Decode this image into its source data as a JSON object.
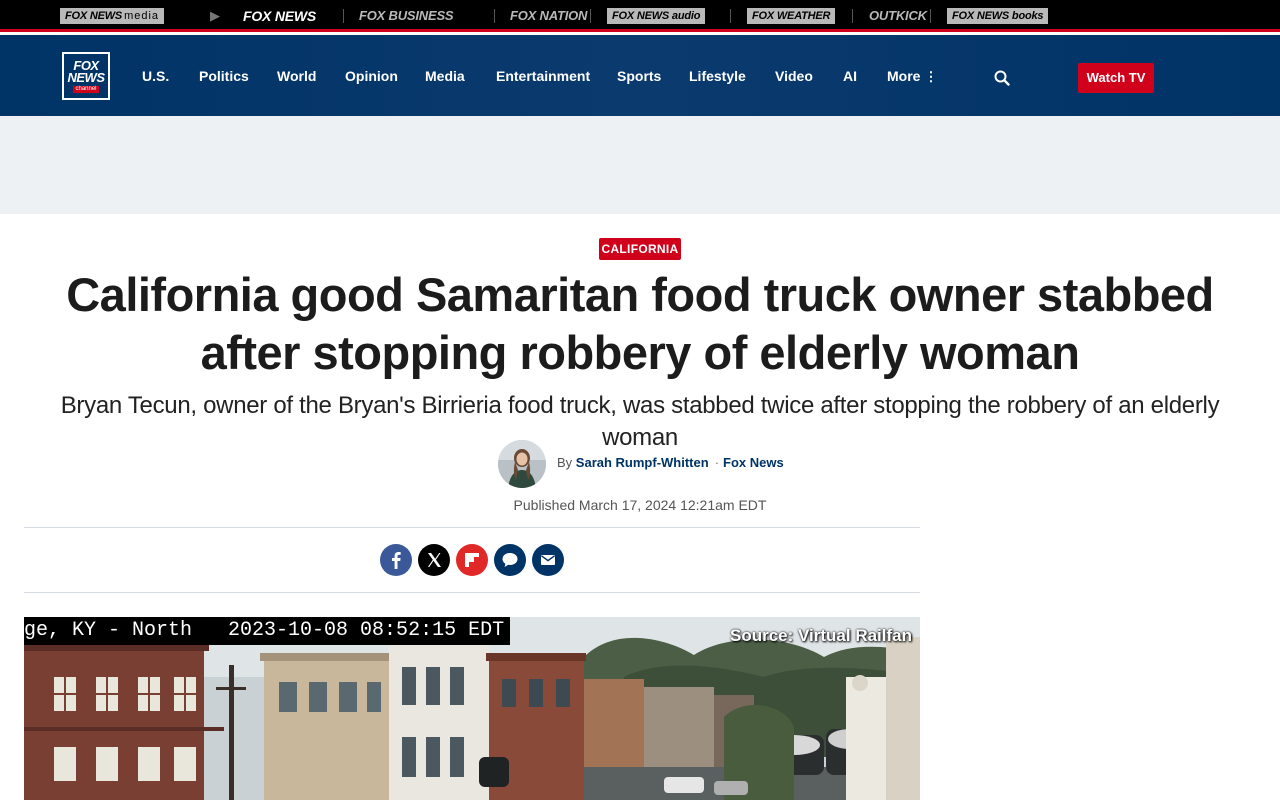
{
  "network_bar": {
    "brands": [
      {
        "key": "fox-news-media",
        "label": "FOX NEWS",
        "suffix": "media"
      },
      {
        "key": "fox-news",
        "label": "FOX NEWS"
      },
      {
        "key": "fox-business",
        "label": "FOX BUSINESS"
      },
      {
        "key": "fox-nation",
        "label": "FOX NATION"
      },
      {
        "key": "fox-news-audio",
        "label": "FOX NEWS audio"
      },
      {
        "key": "fox-weather",
        "label": "FOX WEATHER"
      },
      {
        "key": "outkick",
        "label": "OUTKICK"
      },
      {
        "key": "fox-news-books",
        "label": "FOX NEWS books"
      }
    ],
    "arrow_icon": "play-arrow-icon"
  },
  "header": {
    "logo": {
      "line1": "FOX",
      "line2": "NEWS",
      "line3": "channel"
    },
    "nav": [
      {
        "label": "U.S."
      },
      {
        "label": "Politics"
      },
      {
        "label": "World"
      },
      {
        "label": "Opinion"
      },
      {
        "label": "Media"
      },
      {
        "label": "Entertainment"
      },
      {
        "label": "Sports"
      },
      {
        "label": "Lifestyle"
      },
      {
        "label": "Video"
      },
      {
        "label": "AI"
      },
      {
        "label": "More"
      }
    ],
    "search_icon": "search-icon",
    "watch_tv_label": "Watch TV"
  },
  "article": {
    "category": "CALIFORNIA",
    "headline": "California good Samaritan food truck owner stabbed after stopping robbery of elderly woman",
    "subhead": "Bryan Tecun, owner of the Bryan's Birrieria food truck, was stabbed twice after stopping the robbery of an elderly woman",
    "byline_prefix": "By",
    "author": "Sarah Rumpf-Whitten",
    "byline_dot": "·",
    "source": "Fox News",
    "published": "Published March 17, 2024 12:21am EDT",
    "share": [
      {
        "icon": "facebook-icon",
        "color": "#3b5998"
      },
      {
        "icon": "x-twitter-icon",
        "color": "#000000"
      },
      {
        "icon": "flipboard-icon",
        "color": "#e12828"
      },
      {
        "icon": "comments-icon",
        "color": "#003366"
      },
      {
        "icon": "email-icon",
        "color": "#003366"
      }
    ],
    "hero": {
      "timestamp_overlay": "ge, KY - North   2023-10-08 08:52:15 EDT",
      "source_overlay": "Source: Virtual Railfan"
    }
  },
  "colors": {
    "brand_navy": "#003366",
    "accent_red": "#d0021b",
    "ad_band": "#eef1f4"
  }
}
